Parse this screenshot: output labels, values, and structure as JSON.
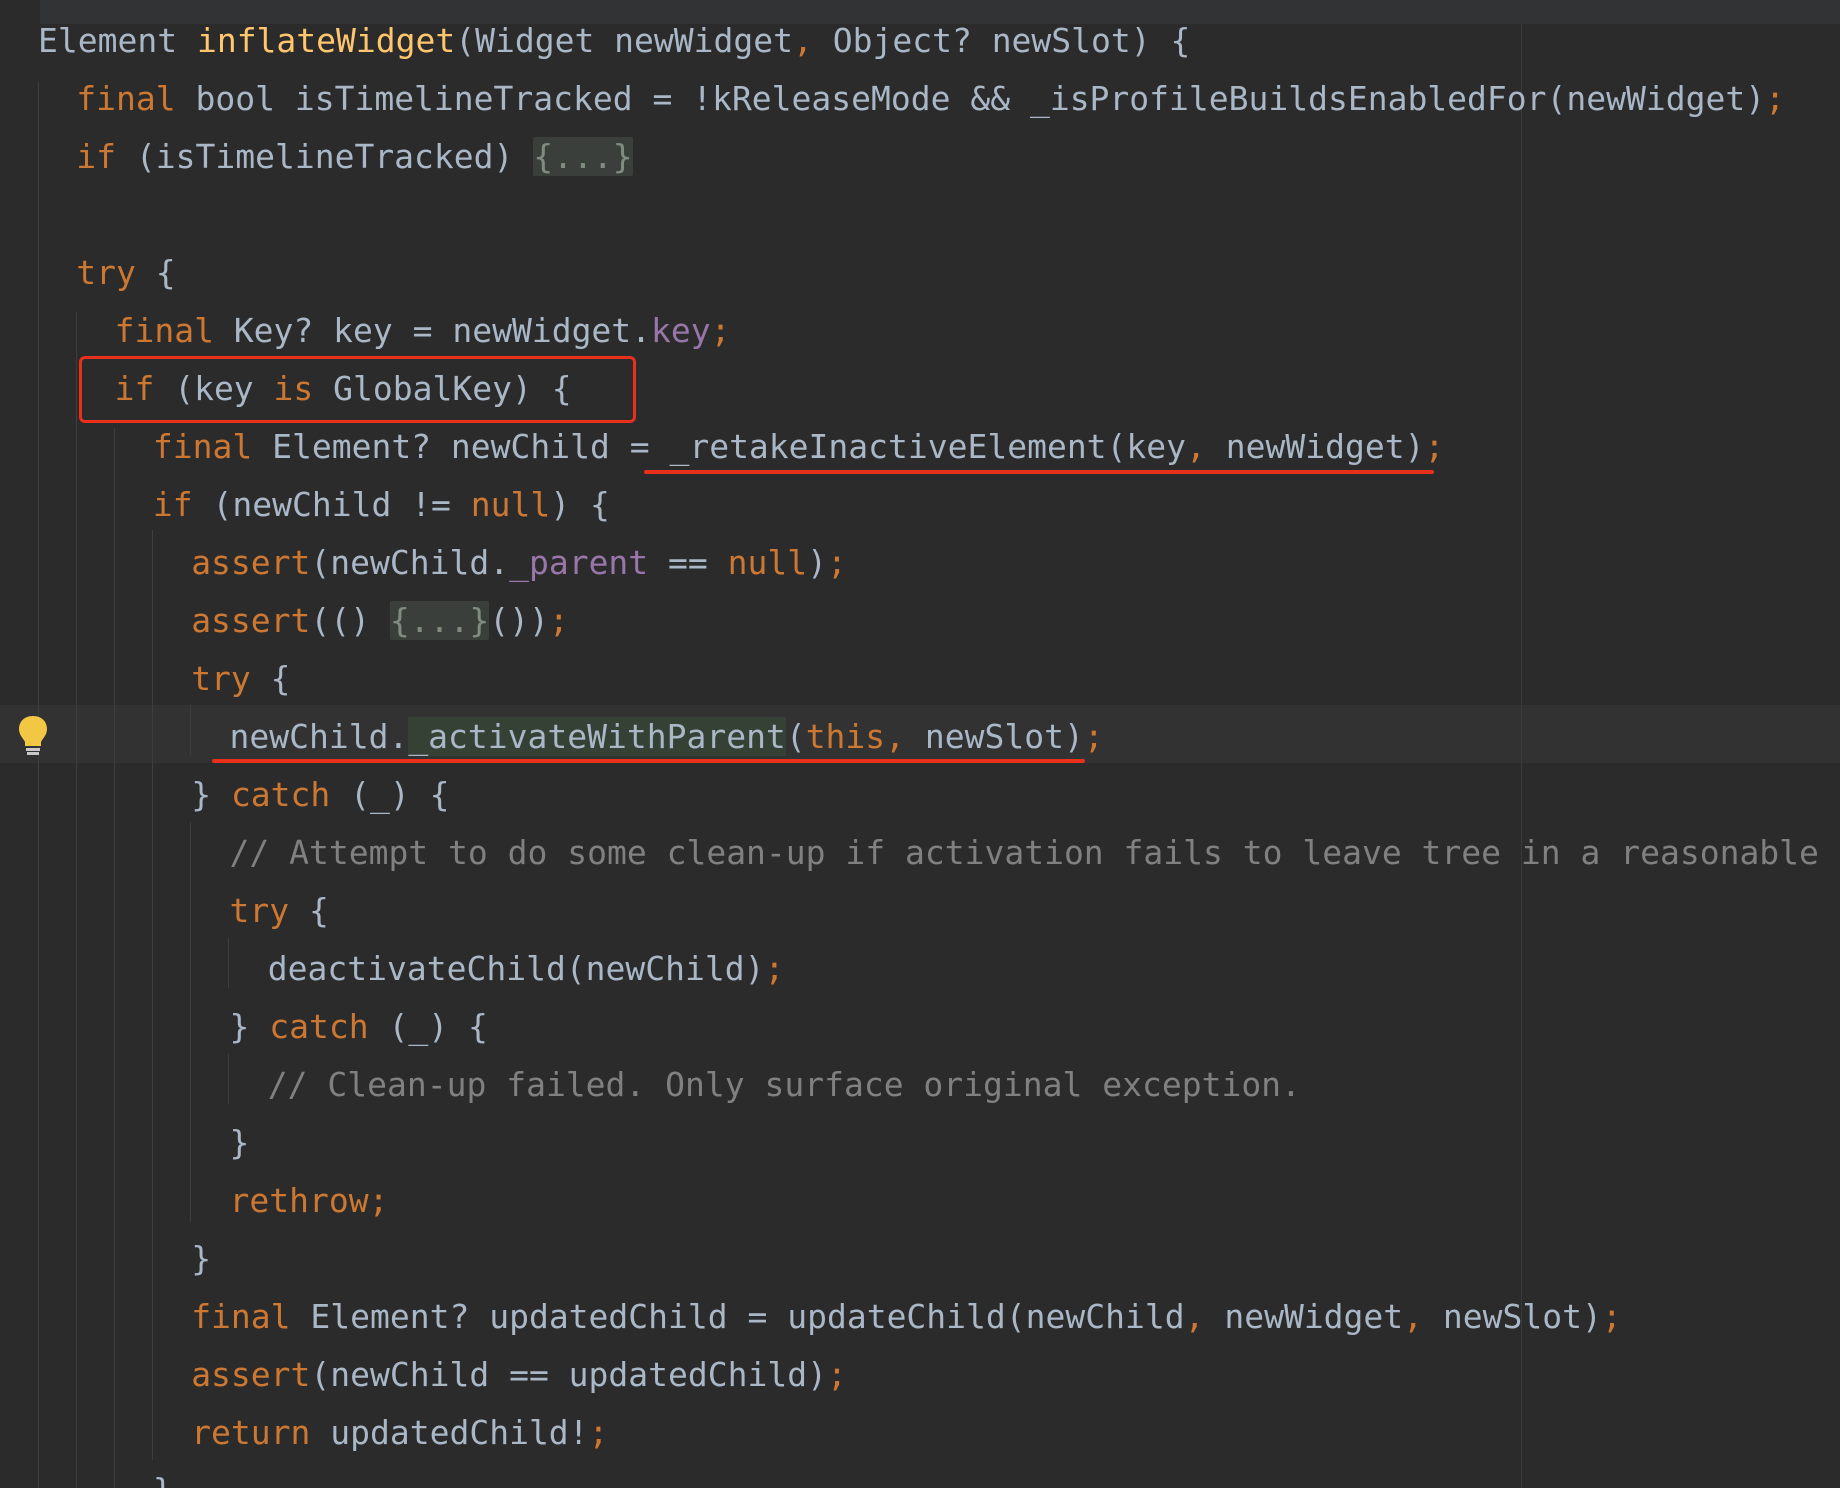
{
  "editor": {
    "colors": {
      "background": "#2b2b2b",
      "keyword": "#cc7832",
      "function": "#ffc66d",
      "field": "#9876aa",
      "plain": "#a9b7c6",
      "comment": "#808080",
      "annotation_red": "#e8301c",
      "bulb": "#f2c744"
    },
    "gutter": {
      "icon": "lightbulb-icon"
    },
    "lines": [
      {
        "tokens": [
          {
            "t": "Element ",
            "c": "pl"
          },
          {
            "t": "inflateWidget",
            "c": "fn"
          },
          {
            "t": "(Widget newWidget",
            "c": "pl"
          },
          {
            "t": ", ",
            "c": "kw"
          },
          {
            "t": "Object? newSlot) {",
            "c": "pl"
          }
        ]
      },
      {
        "tokens": [
          {
            "t": "final ",
            "c": "kw"
          },
          {
            "t": "bool isTimelineTracked = !kReleaseMode && _isProfileBuildsEnabledFor(newWidget)",
            "c": "pl"
          },
          {
            "t": ";",
            "c": "kw"
          }
        ]
      },
      {
        "tokens": [
          {
            "t": "if ",
            "c": "kw"
          },
          {
            "t": "(isTimelineTracked) ",
            "c": "pl"
          },
          {
            "t": "{...}",
            "c": "fold"
          }
        ]
      },
      {
        "tokens": []
      },
      {
        "tokens": [
          {
            "t": "try ",
            "c": "kw"
          },
          {
            "t": "{",
            "c": "pl"
          }
        ]
      },
      {
        "tokens": [
          {
            "t": "final ",
            "c": "kw"
          },
          {
            "t": "Key? key = newWidget.",
            "c": "pl"
          },
          {
            "t": "key",
            "c": "fld"
          },
          {
            "t": ";",
            "c": "kw"
          }
        ]
      },
      {
        "tokens": [
          {
            "t": "if ",
            "c": "kw"
          },
          {
            "t": "(key ",
            "c": "pl"
          },
          {
            "t": "is ",
            "c": "kw"
          },
          {
            "t": "GlobalKey) {",
            "c": "pl"
          }
        ]
      },
      {
        "tokens": [
          {
            "t": "final ",
            "c": "kw"
          },
          {
            "t": "Element? newChild = _retakeInactiveElement(key",
            "c": "pl"
          },
          {
            "t": ", ",
            "c": "kw"
          },
          {
            "t": "newWidget)",
            "c": "pl"
          },
          {
            "t": ";",
            "c": "kw"
          }
        ]
      },
      {
        "tokens": [
          {
            "t": "if ",
            "c": "kw"
          },
          {
            "t": "(newChild != ",
            "c": "pl"
          },
          {
            "t": "null",
            "c": "kw"
          },
          {
            "t": ") {",
            "c": "pl"
          }
        ]
      },
      {
        "tokens": [
          {
            "t": "assert",
            "c": "kw"
          },
          {
            "t": "(newChild.",
            "c": "pl"
          },
          {
            "t": "_parent",
            "c": "fld"
          },
          {
            "t": " == ",
            "c": "pl"
          },
          {
            "t": "null",
            "c": "kw"
          },
          {
            "t": ")",
            "c": "pl"
          },
          {
            "t": ";",
            "c": "kw"
          }
        ]
      },
      {
        "tokens": [
          {
            "t": "assert",
            "c": "kw"
          },
          {
            "t": "(() ",
            "c": "pl"
          },
          {
            "t": "{...}",
            "c": "fold"
          },
          {
            "t": "())",
            "c": "pl"
          },
          {
            "t": ";",
            "c": "kw"
          }
        ]
      },
      {
        "tokens": [
          {
            "t": "try ",
            "c": "kw"
          },
          {
            "t": "{",
            "c": "pl"
          }
        ]
      },
      {
        "tokens": [
          {
            "t": "newChild.",
            "c": "pl"
          },
          {
            "t": "_activateWithParent",
            "c": "semhl"
          },
          {
            "t": "(",
            "c": "pl"
          },
          {
            "t": "this",
            "c": "kw"
          },
          {
            "t": ", ",
            "c": "kw"
          },
          {
            "t": "newSlot)",
            "c": "pl"
          },
          {
            "t": ";",
            "c": "kw"
          }
        ]
      },
      {
        "tokens": [
          {
            "t": "} ",
            "c": "pl"
          },
          {
            "t": "catch ",
            "c": "kw"
          },
          {
            "t": "(_) {",
            "c": "pl"
          }
        ]
      },
      {
        "tokens": [
          {
            "t": "// Attempt to do some clean-up if activation fails to leave tree in a reasonable state.",
            "c": "cmt"
          }
        ]
      },
      {
        "tokens": [
          {
            "t": "try ",
            "c": "kw"
          },
          {
            "t": "{",
            "c": "pl"
          }
        ]
      },
      {
        "tokens": [
          {
            "t": "deactivateChild(newChild)",
            "c": "pl"
          },
          {
            "t": ";",
            "c": "kw"
          }
        ]
      },
      {
        "tokens": [
          {
            "t": "} ",
            "c": "pl"
          },
          {
            "t": "catch ",
            "c": "kw"
          },
          {
            "t": "(_) {",
            "c": "pl"
          }
        ]
      },
      {
        "tokens": [
          {
            "t": "// Clean-up failed. Only surface original exception.",
            "c": "cmt"
          }
        ]
      },
      {
        "tokens": [
          {
            "t": "}",
            "c": "pl"
          }
        ]
      },
      {
        "tokens": [
          {
            "t": "rethrow",
            "c": "kw"
          },
          {
            "t": ";",
            "c": "kw"
          }
        ]
      },
      {
        "tokens": [
          {
            "t": "}",
            "c": "pl"
          }
        ]
      },
      {
        "tokens": [
          {
            "t": "final ",
            "c": "kw"
          },
          {
            "t": "Element? updatedChild = updateChild(newChild",
            "c": "pl"
          },
          {
            "t": ", ",
            "c": "kw"
          },
          {
            "t": "newWidget",
            "c": "pl"
          },
          {
            "t": ", ",
            "c": "kw"
          },
          {
            "t": "newSlot)",
            "c": "pl"
          },
          {
            "t": ";",
            "c": "kw"
          }
        ]
      },
      {
        "tokens": [
          {
            "t": "assert",
            "c": "kw"
          },
          {
            "t": "(newChild == updatedChild)",
            "c": "pl"
          },
          {
            "t": ";",
            "c": "kw"
          }
        ]
      },
      {
        "tokens": [
          {
            "t": "return ",
            "c": "kw"
          },
          {
            "t": "updatedChild!",
            "c": "pl"
          },
          {
            "t": ";",
            "c": "kw"
          }
        ]
      },
      {
        "tokens": [
          {
            "t": "}",
            "c": "pl"
          }
        ]
      }
    ]
  }
}
